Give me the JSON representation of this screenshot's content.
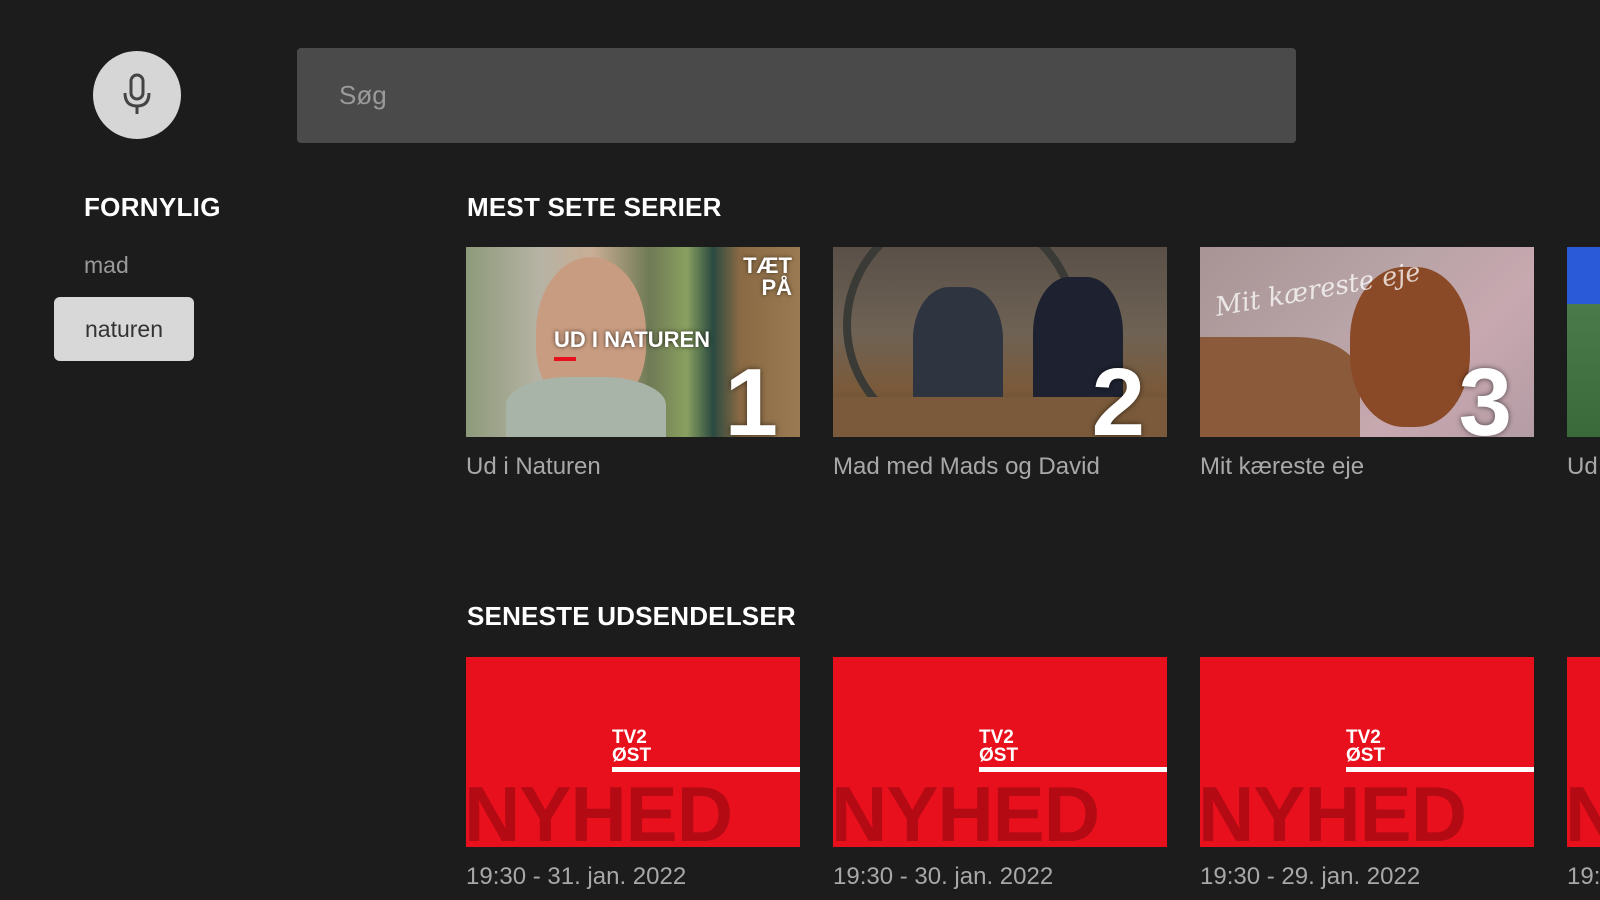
{
  "search": {
    "placeholder": "Søg"
  },
  "icons": {
    "mic": "mic-icon"
  },
  "sidebar": {
    "title": "FORNYLIG",
    "recent": [
      "mad",
      "naturen"
    ]
  },
  "sections": {
    "most_watched": {
      "title": "MEST SETE SERIER",
      "items": [
        {
          "caption": "Ud i Naturen",
          "rank": "1",
          "overlay_title": "UD I NATUREN",
          "corner_logo_line1": "TÆT",
          "corner_logo_line2": "PÅ"
        },
        {
          "caption": "Mad med Mads og David",
          "rank": "2"
        },
        {
          "caption": "Mit kæreste eje",
          "rank": "3",
          "overlay_script": "Mit kæreste eje"
        },
        {
          "caption": "Ud"
        }
      ]
    },
    "latest": {
      "title": "SENESTE UDSENDELSER",
      "logo_line1": "TV2",
      "logo_line2": "ØST",
      "word": "NYHED",
      "items": [
        {
          "caption": "19:30 - 31. jan. 2022"
        },
        {
          "caption": "19:30 - 30. jan. 2022"
        },
        {
          "caption": "19:30 - 29. jan. 2022"
        },
        {
          "caption": "19:"
        }
      ]
    }
  },
  "colors": {
    "background": "#1c1c1c",
    "search_bg": "#4a4a4a",
    "accent_red": "#e8101c",
    "caption": "#a8a8a8"
  }
}
